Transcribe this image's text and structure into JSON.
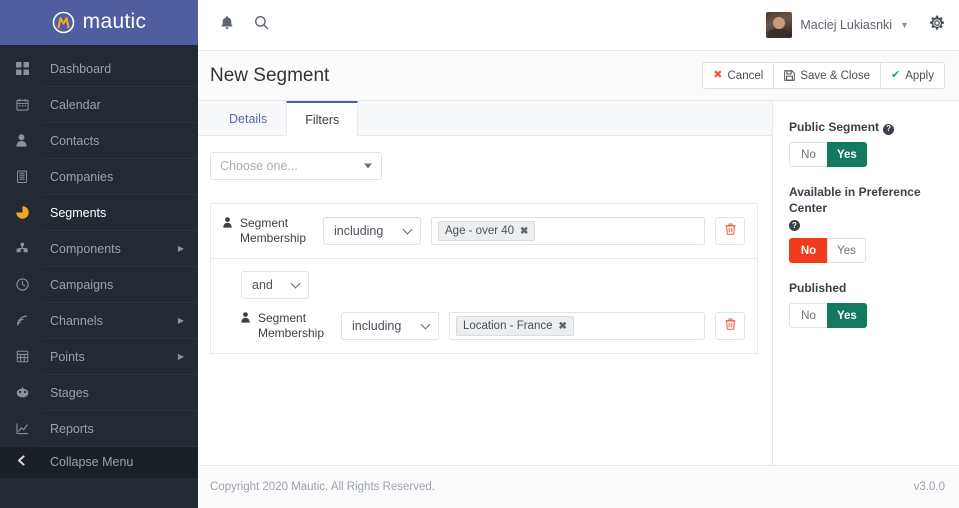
{
  "brand": {
    "name": "mautic",
    "logo_icon": "mautic-circle-m-icon"
  },
  "sidebar": {
    "items": [
      {
        "label": "Dashboard",
        "icon": "grid-icon",
        "has_submenu": false,
        "active": false
      },
      {
        "label": "Calendar",
        "icon": "calendar-icon",
        "has_submenu": false,
        "active": false
      },
      {
        "label": "Contacts",
        "icon": "person-icon",
        "has_submenu": false,
        "active": false
      },
      {
        "label": "Companies",
        "icon": "building-icon",
        "has_submenu": false,
        "active": false
      },
      {
        "label": "Segments",
        "icon": "pie-chart-icon",
        "has_submenu": false,
        "active": true
      },
      {
        "label": "Components",
        "icon": "puzzle-icon",
        "has_submenu": true,
        "active": false
      },
      {
        "label": "Campaigns",
        "icon": "clock-icon",
        "has_submenu": false,
        "active": false
      },
      {
        "label": "Channels",
        "icon": "rss-icon",
        "has_submenu": true,
        "active": false
      },
      {
        "label": "Points",
        "icon": "table-icon",
        "has_submenu": true,
        "active": false
      },
      {
        "label": "Stages",
        "icon": "gauge-icon",
        "has_submenu": false,
        "active": false
      },
      {
        "label": "Reports",
        "icon": "line-chart-icon",
        "has_submenu": false,
        "active": false
      }
    ],
    "collapse_label": "Collapse Menu",
    "collapse_icon": "chevron-left-icon"
  },
  "topbar": {
    "notifications_icon": "bell-icon",
    "search_icon": "search-icon",
    "user_name": "Maciej Lukiasnki",
    "user_caret_icon": "chevron-down-icon",
    "settings_icon": "gear-icon",
    "avatar_icon": "user-avatar"
  },
  "page_header": {
    "title": "New Segment",
    "buttons": [
      {
        "label": "Cancel",
        "icon": "x-icon",
        "icon_glyph": "✖",
        "icon_color": "#f05a3c"
      },
      {
        "label": "Save & Close",
        "icon": "save-icon",
        "icon_glyph": "Ὃe",
        "icon_color": "#4a5059"
      },
      {
        "label": "Apply",
        "icon": "check-icon",
        "icon_glyph": "✔",
        "icon_color": "#17a589"
      }
    ]
  },
  "tabs": [
    {
      "label": "Details",
      "active": false
    },
    {
      "label": "Filters",
      "active": true
    }
  ],
  "filters": {
    "choose_placeholder": "Choose one...",
    "groups": [
      {
        "nested": false,
        "operator": null,
        "field_label": "Segment Membership",
        "field_icon": "person-icon",
        "condition": "including",
        "tags": [
          {
            "label": "Age - over 40",
            "remove_icon": "x-icon"
          }
        ],
        "delete_icon": "trash-icon"
      },
      {
        "nested": true,
        "operator": "and",
        "field_label": "Segment Membership",
        "field_icon": "person-icon",
        "condition": "including",
        "tags": [
          {
            "label": "Location - France",
            "remove_icon": "x-icon"
          }
        ],
        "delete_icon": "trash-icon"
      }
    ]
  },
  "right_panel": {
    "options": [
      {
        "label": "Public Segment",
        "help_icon": "question-mark-icon",
        "has_help": true,
        "no_label": "No",
        "yes_label": "Yes",
        "selected": "yes"
      },
      {
        "label": "Available in Preference Center",
        "help_icon": "question-mark-icon",
        "has_help": true,
        "no_label": "No",
        "yes_label": "Yes",
        "selected": "no"
      },
      {
        "label": "Published",
        "help_icon": null,
        "has_help": false,
        "no_label": "No",
        "yes_label": "Yes",
        "selected": "yes"
      }
    ]
  },
  "footer": {
    "copyright": "Copyright 2020 Mautic. All Rights Reserved.",
    "version": "v3.0.0"
  },
  "colors": {
    "brand_purple": "#4e5e9e",
    "sidebar_dark": "#242a33",
    "accent_orange": "#f5a623",
    "green_yes": "#137a5f",
    "red_no": "#f1391c",
    "danger": "#f05a3c",
    "teal": "#17a589"
  }
}
